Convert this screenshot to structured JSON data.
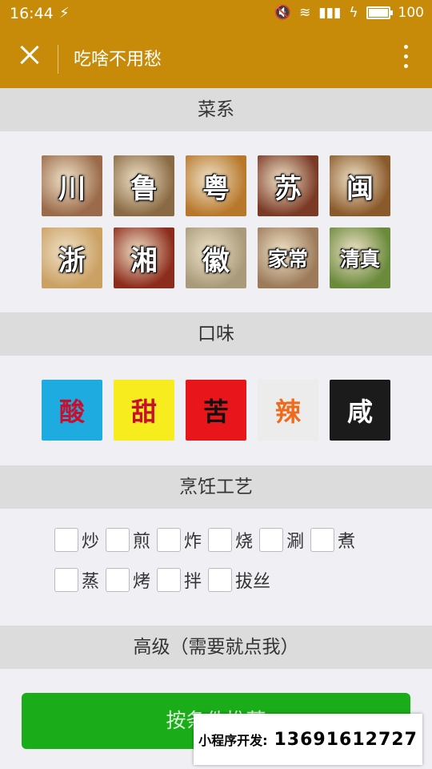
{
  "status_bar": {
    "time": "16:44",
    "usb_icon": "usb-icon",
    "battery": "100"
  },
  "navbar": {
    "title": "吃啥不用愁"
  },
  "sections": {
    "cuisine": "菜系",
    "taste": "口味",
    "craft": "烹饪工艺",
    "advanced": "高级（需要就点我）"
  },
  "cuisines": [
    "川",
    "鲁",
    "粤",
    "苏",
    "闽",
    "浙",
    "湘",
    "徽",
    "家常",
    "清真"
  ],
  "cuisine_colors": [
    "#9a6a4a",
    "#8a6a44",
    "#b7782c",
    "#7b3a26",
    "#8b5a2c",
    "#caa063",
    "#8c2c1c",
    "#a89a7a",
    "#9c7a5a",
    "#6a8a3c"
  ],
  "tastes": [
    {
      "label": "酸",
      "bg": "#1eabe0",
      "color": "#c8102e"
    },
    {
      "label": "甜",
      "bg": "#f7ec1e",
      "color": "#c8102e"
    },
    {
      "label": "苦",
      "bg": "#e8161a",
      "color": "#111111"
    },
    {
      "label": "辣",
      "bg": "#ececec",
      "color": "#ee6a1c"
    },
    {
      "label": "咸",
      "bg": "#1b1b1b",
      "color": "#ffffff"
    }
  ],
  "crafts_row1": [
    "炒",
    "煎",
    "炸",
    "烧",
    "涮",
    "煮"
  ],
  "crafts_row2": [
    "蒸",
    "烤",
    "拌",
    "拔丝"
  ],
  "submit_label": "按条件推荐",
  "promo": {
    "label": "小程序开发:",
    "phone": "13691612727"
  }
}
